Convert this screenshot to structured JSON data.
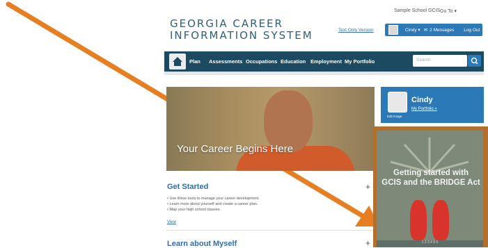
{
  "header": {
    "top_links": [
      "Sample School GCIS",
      "Go To"
    ],
    "brand_line1": "GEORGIA CAREER",
    "brand_line2": "INFORMATION SYSTEM",
    "text_only": "Text Only Version",
    "user": "Cindy",
    "messages": "2 Messages",
    "logout": "Log Out"
  },
  "nav": {
    "items": [
      "Plan",
      "Assessments",
      "Occupations",
      "Education",
      "Employment",
      "My Portfolio"
    ],
    "search_placeholder": "Search"
  },
  "hero": {
    "caption": "Your Career Begins Here"
  },
  "get_started": {
    "title": "Get Started",
    "bullets": [
      "Use these tools to manage your career development.",
      "Learn more about yourself and create a career plan.",
      "Map your high school classes."
    ],
    "view": "View"
  },
  "learn_about": {
    "title": "Learn about Myself"
  },
  "profile": {
    "name": "Cindy",
    "portfolio_link": "My Portfolio »",
    "edit_image": "Edit Image"
  },
  "promo": {
    "line1": "Getting started with",
    "line2": "GCIS and the BRIDGE Act",
    "pager": "1 2 3 4 5 6"
  },
  "colors": {
    "nav": "#1b4a61",
    "accent": "#2b79b6",
    "arrow": "#e67e22",
    "promo_border": "#b26f2d"
  }
}
